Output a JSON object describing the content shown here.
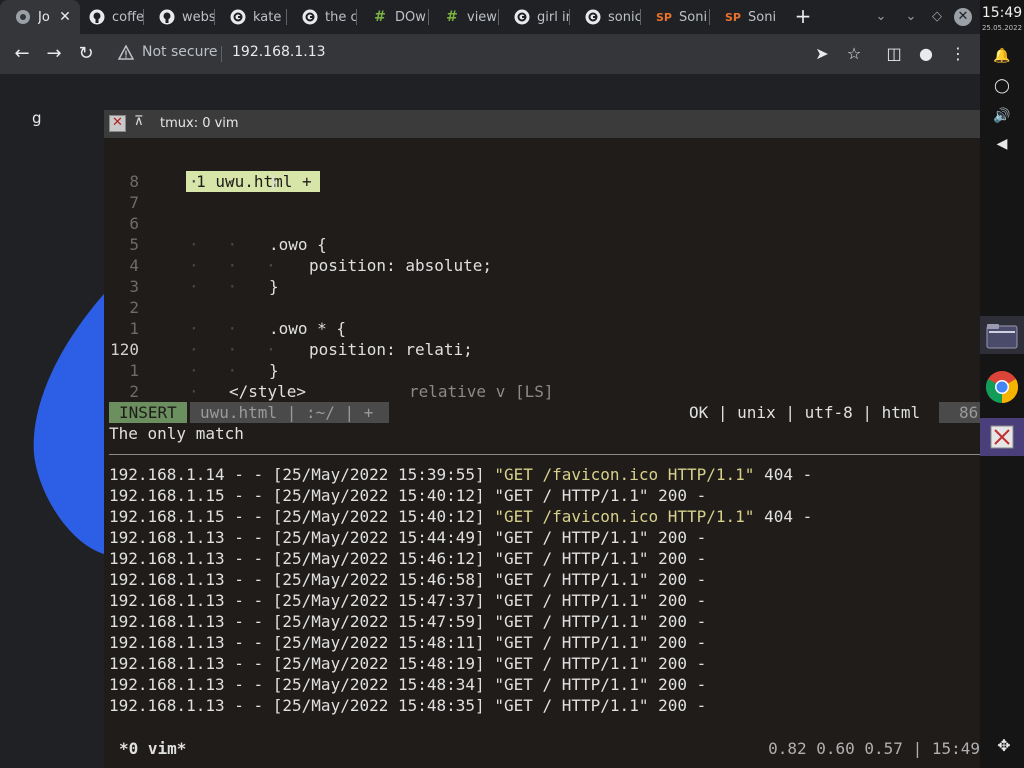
{
  "tabs": [
    {
      "label": "Jo",
      "icon": "chrome-globe-icon",
      "active": true
    },
    {
      "label": "coffe",
      "icon": "github-icon"
    },
    {
      "label": "webs",
      "icon": "github-icon"
    },
    {
      "label": "kate",
      "icon": "google-icon"
    },
    {
      "label": "the c",
      "icon": "google-icon"
    },
    {
      "label": "DOw",
      "icon": "hash-icon"
    },
    {
      "label": "view",
      "icon": "hash-icon"
    },
    {
      "label": "girl ir",
      "icon": "google-icon"
    },
    {
      "label": "sonic",
      "icon": "google-icon"
    },
    {
      "label": "Soni",
      "icon": "sp-icon"
    },
    {
      "label": "Soni",
      "icon": "sp-icon"
    }
  ],
  "toolbar": {
    "security_label": "Not secure",
    "url": "192.168.1.13"
  },
  "page": {
    "text": "g"
  },
  "window": {
    "title": "tmux: 0 vim"
  },
  "vim": {
    "tab_label": "1 uwu.html +",
    "lines": [
      {
        "num": "8",
        "dots": "·   ·",
        "indent": 3,
        "text": "}"
      },
      {
        "num": "7",
        "dots": "",
        "indent": 0,
        "text": ""
      },
      {
        "num": "6",
        "dots": "",
        "indent": 0,
        "text": ""
      },
      {
        "num": "5",
        "dots": "·   ·",
        "indent": 3,
        "text": ".owo {"
      },
      {
        "num": "4",
        "dots": "·   ·   ·",
        "indent": 4,
        "text": "position: absolute;"
      },
      {
        "num": "3",
        "dots": "·   ·",
        "indent": 3,
        "text": "}"
      },
      {
        "num": "2",
        "dots": "",
        "indent": 0,
        "text": ""
      },
      {
        "num": "1",
        "dots": "·   ·",
        "indent": 3,
        "text": ".owo * {"
      },
      {
        "num": "120",
        "dots": "·   ·   ·",
        "indent": 4,
        "text": "position: relati;",
        "current": true
      },
      {
        "num": "1",
        "dots": "·   ·",
        "indent": 3,
        "text": "}"
      },
      {
        "num": "2",
        "dots": "·",
        "indent": 2,
        "text": "</style>"
      }
    ],
    "completion": "relative v [LS]",
    "mode": "INSERT",
    "status_file": "uwu.html | :~/ | +",
    "status_right": "OK | unix | utf-8 | html",
    "status_percent": "86",
    "message": "The only match"
  },
  "log": [
    {
      "ip": "192.168.1.14",
      "date": "[25/May/2022 15:39:55]",
      "request": "\"GET /favicon.ico HTTP/1.1\"",
      "status": "404 -",
      "highlight": true
    },
    {
      "ip": "192.168.1.15",
      "date": "[25/May/2022 15:40:12]",
      "request": "\"GET / HTTP/1.1\"",
      "status": "200 -",
      "highlight": false
    },
    {
      "ip": "192.168.1.15",
      "date": "[25/May/2022 15:40:12]",
      "request": "\"GET /favicon.ico HTTP/1.1\"",
      "status": "404 -",
      "highlight": true
    },
    {
      "ip": "192.168.1.13",
      "date": "[25/May/2022 15:44:49]",
      "request": "\"GET / HTTP/1.1\"",
      "status": "200 -",
      "highlight": false
    },
    {
      "ip": "192.168.1.13",
      "date": "[25/May/2022 15:46:12]",
      "request": "\"GET / HTTP/1.1\"",
      "status": "200 -",
      "highlight": false
    },
    {
      "ip": "192.168.1.13",
      "date": "[25/May/2022 15:46:58]",
      "request": "\"GET / HTTP/1.1\"",
      "status": "200 -",
      "highlight": false
    },
    {
      "ip": "192.168.1.13",
      "date": "[25/May/2022 15:47:37]",
      "request": "\"GET / HTTP/1.1\"",
      "status": "200 -",
      "highlight": false
    },
    {
      "ip": "192.168.1.13",
      "date": "[25/May/2022 15:47:59]",
      "request": "\"GET / HTTP/1.1\"",
      "status": "200 -",
      "highlight": false
    },
    {
      "ip": "192.168.1.13",
      "date": "[25/May/2022 15:48:11]",
      "request": "\"GET / HTTP/1.1\"",
      "status": "200 -",
      "highlight": false
    },
    {
      "ip": "192.168.1.13",
      "date": "[25/May/2022 15:48:19]",
      "request": "\"GET / HTTP/1.1\"",
      "status": "200 -",
      "highlight": false
    },
    {
      "ip": "192.168.1.13",
      "date": "[25/May/2022 15:48:34]",
      "request": "\"GET / HTTP/1.1\"",
      "status": "200 -",
      "highlight": false
    },
    {
      "ip": "192.168.1.13",
      "date": "[25/May/2022 15:48:35]",
      "request": "\"GET / HTTP/1.1\"",
      "status": "200 -",
      "highlight": false
    }
  ],
  "tmux": {
    "window_name": "*0 vim*",
    "status_right": "0.82 0.60 0.57 | 15:49"
  },
  "panel": {
    "time": "15:49",
    "date": "25.05.2022"
  },
  "colors": {
    "insert_mode": "#6b8f5e",
    "vim_tab": "#d7e6a8",
    "log_highlight": "#d7d18a",
    "sp_icon": "#e8712b"
  }
}
